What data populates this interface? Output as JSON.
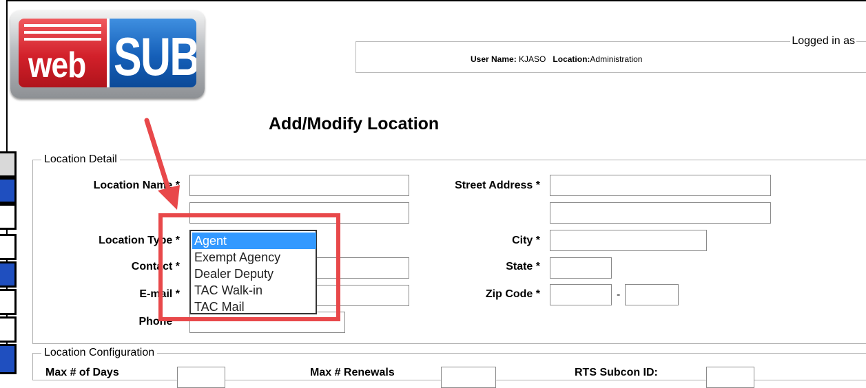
{
  "logo": {
    "left_text": "web",
    "right_text": "SUB"
  },
  "session": {
    "legend": "Logged in as",
    "user_name_label": "User Name:",
    "user_name": "KJASO",
    "location_label": "Location:",
    "location": "Administration"
  },
  "page": {
    "title": "Add/Modify Location"
  },
  "location_detail": {
    "legend": "Location Detail",
    "location_name_label": "Location Name *",
    "location_type_label": "Location Type *",
    "contact_label": "Contact *",
    "email_label": "E-mail *",
    "phone_label": "Phone *",
    "street_address_label": "Street Address *",
    "city_label": "City *",
    "state_label": "State *",
    "zip_label": "Zip Code *",
    "zip_separator": "-"
  },
  "location_type_options": [
    "Agent",
    "Exempt Agency",
    "Dealer Deputy",
    "TAC Walk-in",
    "TAC Mail"
  ],
  "location_type_selected": "Agent",
  "location_config": {
    "legend": "Location Configuration",
    "max_days_label": "Max # of Days",
    "max_renewals_label": "Max # Renewals",
    "rts_label": "RTS Subcon ID:"
  },
  "colors": {
    "accent_highlight": "#e8484a",
    "selection": "#3399ff",
    "logo_red": "#d2202a",
    "logo_blue": "#155fb8"
  }
}
